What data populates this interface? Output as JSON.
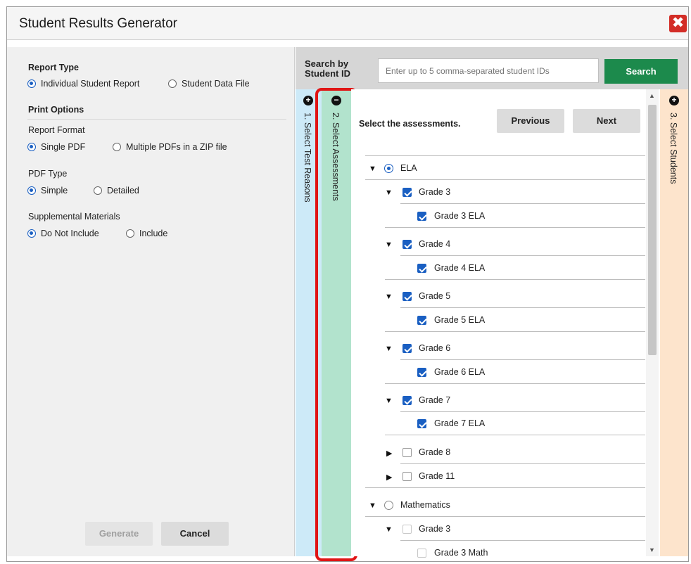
{
  "dialog": {
    "title": "Student Results Generator",
    "close_icon": "close-icon",
    "close_glyph": "✖"
  },
  "report_type": {
    "heading": "Report Type",
    "options": [
      "Individual Student Report",
      "Student Data File"
    ],
    "selected": "Individual Student Report"
  },
  "print_options": {
    "heading": "Print Options",
    "report_format": {
      "label": "Report Format",
      "options": [
        "Single PDF",
        "Multiple PDFs in a ZIP file"
      ],
      "selected": "Single PDF"
    },
    "pdf_type": {
      "label": "PDF Type",
      "options": [
        "Simple",
        "Detailed"
      ],
      "selected": "Simple"
    },
    "supplemental": {
      "label": "Supplemental Materials",
      "options": [
        "Do Not Include",
        "Include"
      ],
      "selected": "Do Not Include"
    }
  },
  "footer": {
    "generate_label": "Generate",
    "cancel_label": "Cancel"
  },
  "search": {
    "label_line1": "Search by",
    "label_line2": "Student ID",
    "placeholder": "Enter up to 5 comma-separated student IDs",
    "button_label": "Search"
  },
  "steps": [
    {
      "label": "1. Select Test Reasons",
      "icon": "plus-circle-icon",
      "glyph": "+"
    },
    {
      "label": "2. Select Assessments",
      "icon": "minus-circle-icon",
      "glyph": "−"
    },
    {
      "label": "3. Select Students",
      "icon": "plus-circle-icon",
      "glyph": "+"
    }
  ],
  "assessments": {
    "instruction": "Select the assessments.",
    "previous_label": "Previous",
    "next_label": "Next",
    "subjects": [
      {
        "name": "ELA",
        "selected": true,
        "expanded": true,
        "grades": [
          {
            "name": "Grade 3",
            "checked": true,
            "expanded": true,
            "tests": [
              {
                "name": "Grade 3 ELA",
                "checked": true
              }
            ]
          },
          {
            "name": "Grade 4",
            "checked": true,
            "expanded": true,
            "tests": [
              {
                "name": "Grade 4 ELA",
                "checked": true
              }
            ]
          },
          {
            "name": "Grade 5",
            "checked": true,
            "expanded": true,
            "tests": [
              {
                "name": "Grade 5 ELA",
                "checked": true
              }
            ]
          },
          {
            "name": "Grade 6",
            "checked": true,
            "expanded": true,
            "tests": [
              {
                "name": "Grade 6 ELA",
                "checked": true
              }
            ]
          },
          {
            "name": "Grade 7",
            "checked": true,
            "expanded": true,
            "tests": [
              {
                "name": "Grade 7 ELA",
                "checked": true
              }
            ]
          },
          {
            "name": "Grade 8",
            "checked": false,
            "expanded": false,
            "tests": []
          },
          {
            "name": "Grade 11",
            "checked": false,
            "expanded": false,
            "tests": []
          }
        ]
      },
      {
        "name": "Mathematics",
        "selected": false,
        "expanded": true,
        "grades": [
          {
            "name": "Grade 3",
            "checked": false,
            "expanded": true,
            "tests": [
              {
                "name": "Grade 3 Math",
                "checked": false
              }
            ]
          }
        ]
      }
    ]
  },
  "colors": {
    "accent_blue": "#1a5fc2",
    "search_green": "#1c8a4c",
    "close_red": "#d32d27",
    "highlight_red": "#e01515",
    "step1_bg": "#cdeaf8",
    "step2_bg": "#b2e3cd",
    "step3_bg": "#fde4cc"
  }
}
